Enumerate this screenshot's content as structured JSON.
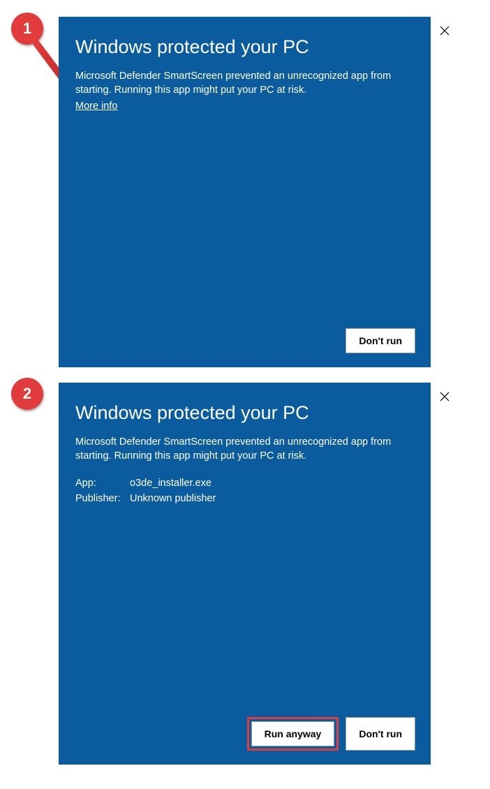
{
  "steps": {
    "one": "1",
    "two": "2"
  },
  "dialog1": {
    "title": "Windows protected your PC",
    "body": "Microsoft Defender SmartScreen prevented an unrecognized app from starting. Running this app might put your PC at risk.",
    "more_info": "More info",
    "dont_run": "Don't run"
  },
  "dialog2": {
    "title": "Windows protected your PC",
    "body": "Microsoft Defender SmartScreen prevented an unrecognized app from starting. Running this app might put your PC at risk.",
    "app_label": "App:",
    "app_value": "o3de_installer.exe",
    "publisher_label": "Publisher:",
    "publisher_value": "Unknown publisher",
    "run_anyway": "Run anyway",
    "dont_run": "Don't run"
  }
}
